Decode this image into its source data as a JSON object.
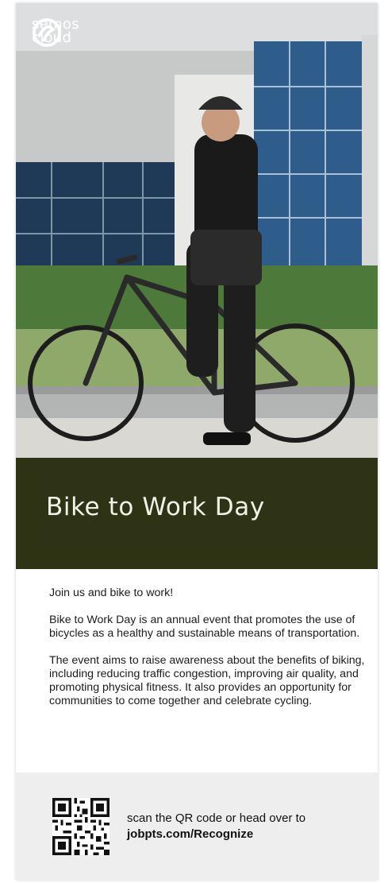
{
  "brand": {
    "name": "semos cloud",
    "word1": "semos",
    "word2": "cloud"
  },
  "event": {
    "title": "Bike to Work Day"
  },
  "content": {
    "intro": "Join us and bike to work!",
    "paragraph1": "Bike to Work Day is an annual event that promotes the use of bicycles as a healthy and sustainable means of transportation.",
    "paragraph2": "The event aims to raise awareness about the benefits of biking, including reducing traffic congestion, improving air quality, and promoting physical fitness. It also provides an opportunity for communities to come together and celebrate cycling."
  },
  "footer": {
    "cta_text": "scan the QR code or head over to",
    "url": "jobpts.com/Recognize"
  },
  "colors": {
    "banner": "#2f3315",
    "banner_text": "#f1f1e8",
    "footer_bg": "#eeeeee"
  },
  "icons": {
    "logo": "semos-logo-icon",
    "qr": "qr-code-icon"
  }
}
